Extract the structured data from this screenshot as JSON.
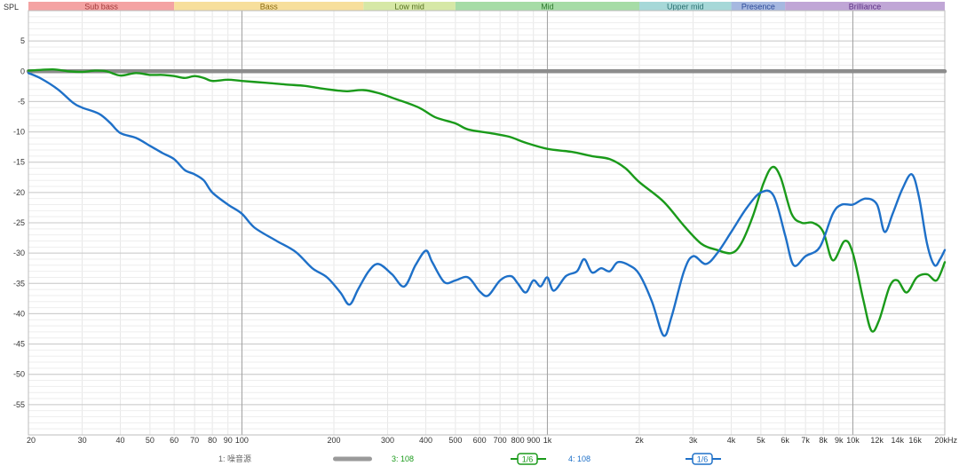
{
  "chart_data": {
    "type": "line",
    "ylabel": "SPL",
    "xlim": [
      20,
      20000
    ],
    "ylim": [
      -60,
      10
    ],
    "x_scale": "log",
    "grid": true,
    "bands": [
      {
        "name": "Sub bass",
        "from": 20,
        "to": 60,
        "color": "#f4a3a3",
        "text_color": "#a23a3a"
      },
      {
        "name": "Bass",
        "from": 60,
        "to": 250,
        "color": "#f7df9c",
        "text_color": "#8a6a10"
      },
      {
        "name": "Low mid",
        "from": 250,
        "to": 500,
        "color": "#d6e8a6",
        "text_color": "#557020"
      },
      {
        "name": "Mid",
        "from": 500,
        "to": 2000,
        "color": "#a6dca6",
        "text_color": "#2f7a2f"
      },
      {
        "name": "Upper mid",
        "from": 2000,
        "to": 4000,
        "color": "#a6d8d8",
        "text_color": "#2a7070"
      },
      {
        "name": "Presence",
        "from": 4000,
        "to": 6000,
        "color": "#a6b8e0",
        "text_color": "#2c4a98"
      },
      {
        "name": "Brilliance",
        "from": 6000,
        "to": 20000,
        "color": "#c0a6d6",
        "text_color": "#5b2f84"
      }
    ],
    "y_ticks": [
      5,
      0,
      -5,
      -10,
      -15,
      -20,
      -25,
      -30,
      -35,
      -40,
      -45,
      -50,
      -55
    ],
    "x_ticks": [
      {
        "v": 20,
        "label": "20"
      },
      {
        "v": 30,
        "label": "30"
      },
      {
        "v": 40,
        "label": "40"
      },
      {
        "v": 50,
        "label": "50"
      },
      {
        "v": 60,
        "label": "60"
      },
      {
        "v": 70,
        "label": "70"
      },
      {
        "v": 80,
        "label": "80"
      },
      {
        "v": 90,
        "label": "90"
      },
      {
        "v": 100,
        "label": "100"
      },
      {
        "v": 200,
        "label": "200"
      },
      {
        "v": 300,
        "label": "300"
      },
      {
        "v": 400,
        "label": "400"
      },
      {
        "v": 500,
        "label": "500"
      },
      {
        "v": 600,
        "label": "600"
      },
      {
        "v": 700,
        "label": "700"
      },
      {
        "v": 800,
        "label": "800"
      },
      {
        "v": 900,
        "label": "900"
      },
      {
        "v": 1000,
        "label": "1k"
      },
      {
        "v": 2000,
        "label": "2k"
      },
      {
        "v": 3000,
        "label": "3k"
      },
      {
        "v": 4000,
        "label": "4k"
      },
      {
        "v": 5000,
        "label": "5k"
      },
      {
        "v": 6000,
        "label": "6k"
      },
      {
        "v": 7000,
        "label": "7k"
      },
      {
        "v": 8000,
        "label": "8k"
      },
      {
        "v": 9000,
        "label": "9k"
      },
      {
        "v": 10000,
        "label": "10k"
      },
      {
        "v": 12000,
        "label": "12k",
        "muted": true
      },
      {
        "v": 14000,
        "label": "14k"
      },
      {
        "v": 16000,
        "label": "16k"
      },
      {
        "v": 20000,
        "label": "20kHz"
      }
    ],
    "series": [
      {
        "name": "1: 噪音源",
        "color": "#8c8c8c",
        "width": 4.5,
        "smoothing": "",
        "points": [
          [
            20,
            0
          ],
          [
            20000,
            0
          ]
        ]
      },
      {
        "name": "3: 108",
        "color": "#1a9a1a",
        "width": 2.4,
        "smoothing": "1/6",
        "points": [
          [
            20,
            0.1
          ],
          [
            24,
            0.3
          ],
          [
            27,
            0.0
          ],
          [
            30,
            -0.1
          ],
          [
            33,
            0.1
          ],
          [
            36,
            0.0
          ],
          [
            40,
            -0.7
          ],
          [
            45,
            -0.3
          ],
          [
            50,
            -0.6
          ],
          [
            55,
            -0.6
          ],
          [
            60,
            -0.8
          ],
          [
            65,
            -1.1
          ],
          [
            70,
            -0.8
          ],
          [
            75,
            -1.1
          ],
          [
            80,
            -1.6
          ],
          [
            90,
            -1.4
          ],
          [
            100,
            -1.6
          ],
          [
            120,
            -1.9
          ],
          [
            140,
            -2.2
          ],
          [
            160,
            -2.4
          ],
          [
            180,
            -2.8
          ],
          [
            200,
            -3.1
          ],
          [
            220,
            -3.3
          ],
          [
            250,
            -3.1
          ],
          [
            280,
            -3.6
          ],
          [
            320,
            -4.6
          ],
          [
            380,
            -6.0
          ],
          [
            430,
            -7.6
          ],
          [
            500,
            -8.6
          ],
          [
            550,
            -9.6
          ],
          [
            650,
            -10.2
          ],
          [
            750,
            -10.8
          ],
          [
            850,
            -11.8
          ],
          [
            1000,
            -12.8
          ],
          [
            1200,
            -13.3
          ],
          [
            1400,
            -14.0
          ],
          [
            1600,
            -14.5
          ],
          [
            1800,
            -16.0
          ],
          [
            2000,
            -18.3
          ],
          [
            2400,
            -21.5
          ],
          [
            2800,
            -25.5
          ],
          [
            3200,
            -28.5
          ],
          [
            3600,
            -29.5
          ],
          [
            4000,
            -30.0
          ],
          [
            4300,
            -28.5
          ],
          [
            4700,
            -24.0
          ],
          [
            5100,
            -18.5
          ],
          [
            5450,
            -15.8
          ],
          [
            5800,
            -17.5
          ],
          [
            6300,
            -23.5
          ],
          [
            6800,
            -25.0
          ],
          [
            7400,
            -25.0
          ],
          [
            8000,
            -26.5
          ],
          [
            8600,
            -31.2
          ],
          [
            9400,
            -28.0
          ],
          [
            10000,
            -30.0
          ],
          [
            10800,
            -37.5
          ],
          [
            11500,
            -42.8
          ],
          [
            12200,
            -41.0
          ],
          [
            13200,
            -35.5
          ],
          [
            14000,
            -34.5
          ],
          [
            15000,
            -36.5
          ],
          [
            16200,
            -34.0
          ],
          [
            17500,
            -33.5
          ],
          [
            18800,
            -34.5
          ],
          [
            20000,
            -31.5
          ]
        ]
      },
      {
        "name": "4: 108",
        "color": "#1e70c8",
        "width": 2.4,
        "smoothing": "1/6",
        "points": [
          [
            20,
            -0.3
          ],
          [
            22,
            -1.2
          ],
          [
            25,
            -3.0
          ],
          [
            28,
            -5.2
          ],
          [
            30,
            -6.0
          ],
          [
            34,
            -7.0
          ],
          [
            37,
            -8.5
          ],
          [
            40,
            -10.2
          ],
          [
            45,
            -11.0
          ],
          [
            50,
            -12.3
          ],
          [
            55,
            -13.5
          ],
          [
            60,
            -14.5
          ],
          [
            65,
            -16.3
          ],
          [
            70,
            -17.0
          ],
          [
            75,
            -18.0
          ],
          [
            80,
            -20.0
          ],
          [
            90,
            -22.0
          ],
          [
            100,
            -23.5
          ],
          [
            110,
            -25.8
          ],
          [
            130,
            -28.0
          ],
          [
            150,
            -29.8
          ],
          [
            170,
            -32.5
          ],
          [
            190,
            -34.0
          ],
          [
            210,
            -36.5
          ],
          [
            225,
            -38.5
          ],
          [
            240,
            -36.0
          ],
          [
            260,
            -33.0
          ],
          [
            280,
            -31.8
          ],
          [
            310,
            -33.5
          ],
          [
            340,
            -35.5
          ],
          [
            370,
            -32.0
          ],
          [
            400,
            -29.6
          ],
          [
            420,
            -31.5
          ],
          [
            460,
            -34.8
          ],
          [
            500,
            -34.5
          ],
          [
            550,
            -34.0
          ],
          [
            600,
            -36.3
          ],
          [
            640,
            -37.0
          ],
          [
            700,
            -34.5
          ],
          [
            760,
            -33.8
          ],
          [
            800,
            -35.0
          ],
          [
            850,
            -36.5
          ],
          [
            900,
            -34.5
          ],
          [
            950,
            -35.5
          ],
          [
            1000,
            -34.0
          ],
          [
            1050,
            -36.2
          ],
          [
            1150,
            -33.8
          ],
          [
            1250,
            -33.0
          ],
          [
            1320,
            -31.0
          ],
          [
            1400,
            -33.2
          ],
          [
            1500,
            -32.5
          ],
          [
            1600,
            -33.0
          ],
          [
            1700,
            -31.5
          ],
          [
            1850,
            -32.0
          ],
          [
            2000,
            -33.5
          ],
          [
            2200,
            -38.0
          ],
          [
            2400,
            -43.6
          ],
          [
            2550,
            -40.5
          ],
          [
            2800,
            -33.0
          ],
          [
            3000,
            -30.5
          ],
          [
            3300,
            -31.8
          ],
          [
            3600,
            -30.0
          ],
          [
            4000,
            -26.5
          ],
          [
            4500,
            -22.5
          ],
          [
            5000,
            -20.0
          ],
          [
            5500,
            -20.5
          ],
          [
            6000,
            -27.0
          ],
          [
            6400,
            -32.0
          ],
          [
            7000,
            -30.5
          ],
          [
            7800,
            -29.0
          ],
          [
            8600,
            -23.5
          ],
          [
            9200,
            -22.0
          ],
          [
            10000,
            -22.0
          ],
          [
            11000,
            -21.0
          ],
          [
            12000,
            -22.0
          ],
          [
            12700,
            -26.5
          ],
          [
            13500,
            -23.5
          ],
          [
            14500,
            -19.5
          ],
          [
            15600,
            -17.0
          ],
          [
            16500,
            -21.0
          ],
          [
            17500,
            -28.5
          ],
          [
            18500,
            -32.0
          ],
          [
            19300,
            -31.0
          ],
          [
            20000,
            -29.5
          ]
        ]
      }
    ]
  },
  "legend": [
    {
      "label": "1: 噪音源",
      "swatch": "gray-bar",
      "color": "#9a9a9a",
      "text_color": "#666666"
    },
    {
      "label": "3: 108",
      "swatch": "smoothing-badge",
      "badge": "1/6",
      "color": "#1a9a1a",
      "text_color": "#1a9a1a"
    },
    {
      "label": "4: 108",
      "swatch": "smoothing-badge",
      "badge": "1/6",
      "color": "#1e70c8",
      "text_color": "#1e70c8"
    }
  ]
}
